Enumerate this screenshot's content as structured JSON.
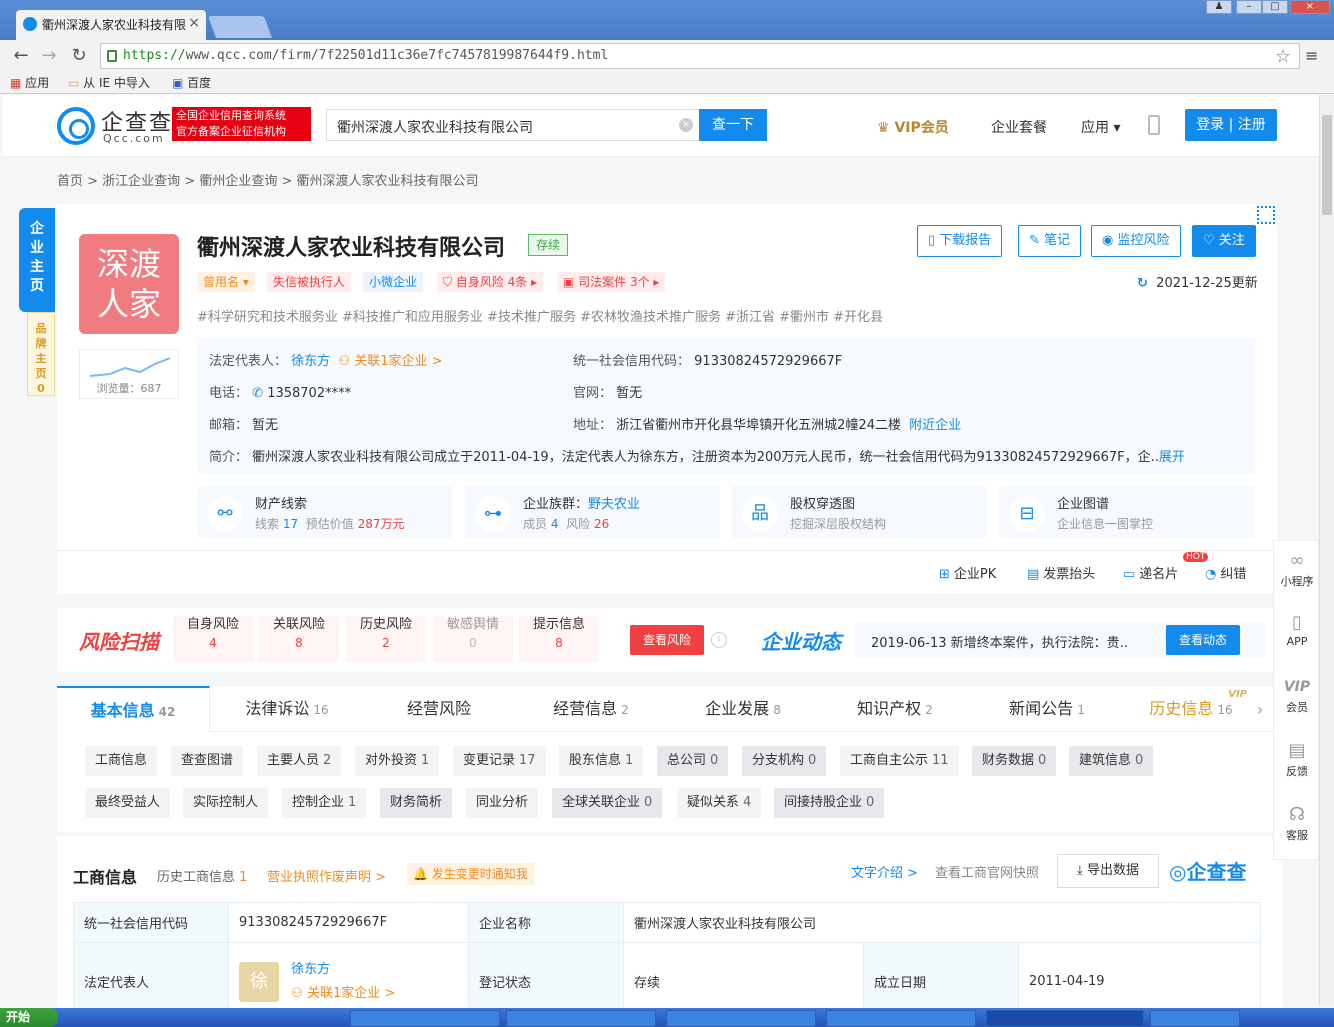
{
  "browser": {
    "tab_title": "衢州深渡人家农业科技有限",
    "url_proto": "https://",
    "url_rest": "www.qcc.com/firm/7f22501d11c36e7fc7457819987644f9.html",
    "bookmarks": [
      "应用",
      "从 IE 中导入",
      "百度"
    ]
  },
  "header": {
    "logo_text": "企查查",
    "logo_sub": "Qcc.com",
    "slogan_line1": "全国企业信用查询系统",
    "slogan_line2": "官方备案企业征信机构",
    "search_value": "衢州深渡人家农业科技有限公司",
    "search_button": "查一下",
    "vip": "VIP会员",
    "suite": "企业套餐",
    "apps": "应用 ▾",
    "login": "登录 | 注册"
  },
  "breadcrumb": "首页 > 浙江企业查询 > 衢州企业查询 > 衢州深渡人家农业科技有限公司",
  "side_tabs": {
    "main": "企业主页",
    "brand": "品牌主页",
    "brand_count": "0"
  },
  "company": {
    "logo_line1": "深渡",
    "logo_line2": "人家",
    "views": "浏览量：687",
    "name": "衢州深渡人家农业科技有限公司",
    "status": "存续",
    "tags": {
      "former": "曾用名 ▾",
      "executed": "失信被执行人",
      "micro": "小微企业",
      "risk": "自身风险 4条 ▸",
      "cases": "司法案件 3个 ▸"
    },
    "hashtags": "#科学研究和技术服务业  #科技推广和应用服务业  #技术推广服务  #农林牧渔技术推广服务  #浙江省  #衢州市  #开化县",
    "buttons": {
      "report": "下载报告",
      "note": "笔记",
      "monitor": "监控风险",
      "follow": "关注"
    },
    "updated": "2021-12-25更新",
    "legal_rep_label": "法定代表人：",
    "legal_rep": "徐东方",
    "related": "关联1家企业 >",
    "credit_label": "统一社会信用代码：",
    "credit_code": "91330824572929667F",
    "phone_label": "电话：",
    "phone": "1358702****",
    "site_label": "官网：",
    "site": "暂无",
    "email_label": "邮箱：",
    "email": "暂无",
    "address_label": "地址：",
    "address": "浙江省衢州市开化县华埠镇开化五洲城2幢24二楼",
    "nearby": "附近企业",
    "intro_label": "简介：",
    "intro": "衢州深渡人家农业科技有限公司成立于2011-04-19，法定代表人为徐东方，注册资本为200万元人民币，统一社会信用代码为91330824572929667F，企..",
    "expand": "展开"
  },
  "features": [
    {
      "title": "财产线索",
      "sub1": "线索",
      "n1": "17",
      "sub2": "预估价值",
      "n2": "287万元"
    },
    {
      "title": "企业族群：",
      "title_link": "野夫农业",
      "sub1": "成员",
      "n1": "4",
      "sub2": "风险",
      "n2": "26"
    },
    {
      "title": "股权穿透图",
      "sub": "挖掘深层股权结构"
    },
    {
      "title": "企业图谱",
      "sub": "企业信息一图掌控"
    }
  ],
  "actions": [
    "企业PK",
    "发票抬头",
    "递名片",
    "纠错"
  ],
  "hot": "HOT",
  "risk": {
    "title": "风险扫描",
    "items": [
      {
        "label": "自身风险",
        "n": "4"
      },
      {
        "label": "关联风险",
        "n": "8"
      },
      {
        "label": "历史风险",
        "n": "2"
      },
      {
        "label": "敏感舆情",
        "n": "0"
      },
      {
        "label": "提示信息",
        "n": "8"
      }
    ],
    "button": "查看风险",
    "dyn_title": "企业动态",
    "dyn_text": "2019-06-13 新增终本案件，执行法院：贵..",
    "dyn_button": "查看动态"
  },
  "tabs": [
    {
      "label": "基本信息",
      "count": "42"
    },
    {
      "label": "法律诉讼",
      "count": "16"
    },
    {
      "label": "经营风险",
      "count": ""
    },
    {
      "label": "经营信息",
      "count": "2"
    },
    {
      "label": "企业发展",
      "count": "8"
    },
    {
      "label": "知识产权",
      "count": "2"
    },
    {
      "label": "新闻公告",
      "count": "1"
    },
    {
      "label": "历史信息",
      "count": "16"
    }
  ],
  "vip_badge": "VIP",
  "subtabs_row1": [
    {
      "label": "工商信息",
      "count": ""
    },
    {
      "label": "查查图谱",
      "count": ""
    },
    {
      "label": "主要人员",
      "count": "2"
    },
    {
      "label": "对外投资",
      "count": "1"
    },
    {
      "label": "变更记录",
      "count": "17"
    },
    {
      "label": "股东信息",
      "count": "1"
    },
    {
      "label": "总公司",
      "count": "0"
    },
    {
      "label": "分支机构",
      "count": "0"
    },
    {
      "label": "工商自主公示",
      "count": "11"
    },
    {
      "label": "财务数据",
      "count": "0"
    },
    {
      "label": "建筑信息",
      "count": "0"
    }
  ],
  "subtabs_row2": [
    {
      "label": "最终受益人",
      "count": ""
    },
    {
      "label": "实际控制人",
      "count": ""
    },
    {
      "label": "控制企业",
      "count": "1"
    },
    {
      "label": "财务简析",
      "count": ""
    },
    {
      "label": "同业分析",
      "count": ""
    },
    {
      "label": "全球关联企业",
      "count": "0"
    },
    {
      "label": "疑似关系",
      "count": "4"
    },
    {
      "label": "间接持股企业",
      "count": "0"
    }
  ],
  "section": {
    "title": "工商信息",
    "history": "历史工商信息",
    "history_n": "1",
    "decl": "营业执照作废声明 >",
    "notify": "发生变更时通知我",
    "intro": "文字介绍 >",
    "snapshot": "查看工商官网快照",
    "export": "导出数据",
    "logo": "企查查",
    "row1": [
      "统一社会信用代码",
      "91330824572929667F",
      "企业名称",
      "衢州深渡人家农业科技有限公司"
    ],
    "row2_label": "法定代表人",
    "row2_avatar": "徐",
    "row2_name": "徐东方",
    "row2_related": "关联1家企业 >",
    "row2_status_label": "登记状态",
    "row2_status": "存续",
    "row2_date_label": "成立日期",
    "row2_date": "2011-04-19"
  },
  "float": [
    "小程序",
    "APP",
    "会员",
    "反馈",
    "客服"
  ],
  "float_vip": "VIP",
  "taskbar": {
    "start": "开始"
  }
}
